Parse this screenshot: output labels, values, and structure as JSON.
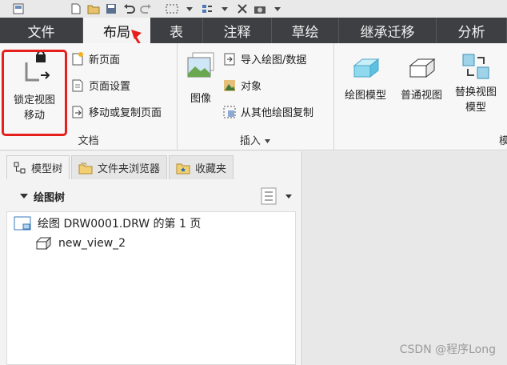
{
  "tabs": [
    "文件",
    "布局",
    "表",
    "注释",
    "草绘",
    "继承迁移",
    "分析"
  ],
  "ribbon": {
    "doc_group": {
      "label": "文档",
      "lock_view": "锁定视图\n移动",
      "new_page": "新页面",
      "page_setup": "页面设置",
      "move_copy_page": "移动或复制页面"
    },
    "insert_group": {
      "label": "插入",
      "image": "图像",
      "import_drawing": "导入绘图/数据",
      "object": "对象",
      "copy_from_other": "从其他绘图复制"
    },
    "model_group": {
      "label_partial": "模型",
      "drawing_model": "绘图模型",
      "general_view": "普通视图",
      "replace_view": "替换视图\n模型"
    }
  },
  "panel": {
    "tabs": [
      "模型树",
      "文件夹浏览器",
      "收藏夹"
    ],
    "tree_title": "绘图树",
    "items": [
      "绘图 DRW0001.DRW 的第 1 页",
      "new_view_2"
    ]
  },
  "watermark": "CSDN @程序Long"
}
